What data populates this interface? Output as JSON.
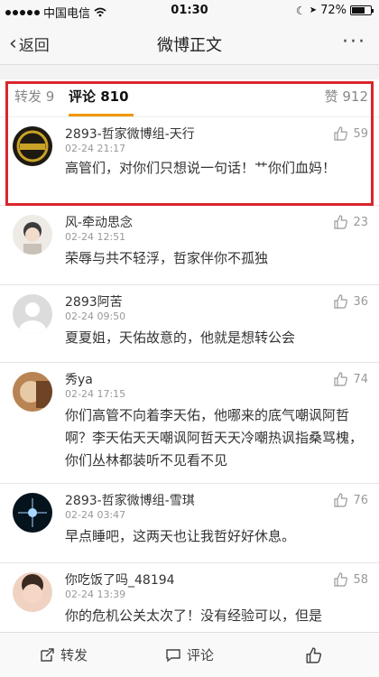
{
  "status": {
    "carrier": "中国电信",
    "time": "01:30",
    "battery": "72%",
    "battery_level": 0.72
  },
  "nav": {
    "back_label": "返回",
    "title": "微博正文",
    "more_label": "···"
  },
  "tabs": {
    "repost": "转发 9",
    "comment": "评论 810",
    "like": "赞 912"
  },
  "comments": [
    {
      "user": "2893-哲家微博组-天行",
      "time": "02-24 21:17",
      "likes": "59",
      "text": "高管们，对你们只想说一句话！艹你们血妈！",
      "avatar_color": "#3a2a12"
    },
    {
      "user": "风-牵动思念",
      "time": "02-24 12:51",
      "likes": "23",
      "text": "荣辱与共不轻浮，哲家伴你不孤独",
      "avatar_color": "#d8cfc8"
    },
    {
      "user": "2893阿苦",
      "time": "02-24 09:50",
      "likes": "36",
      "text": "夏夏姐，天佑故意的，他就是想转公会",
      "avatar_color": "#d9d9d9"
    },
    {
      "user": "秀ya",
      "time": "02-24 17:15",
      "likes": "74",
      "text": "你们高管不向着李天佑，他哪来的底气嘲讽阿哲啊？李天佑天天嘲讽阿哲天天冷嘲热讽指桑骂槐，你们丛林都装听不见看不见",
      "avatar_color": "#a8703e"
    },
    {
      "user": "2893-哲家微博组-雪琪",
      "time": "02-24 03:47",
      "likes": "76",
      "text": "早点睡吧，这两天也让我哲好好休息。",
      "avatar_color": "#0b1d2a"
    },
    {
      "user": "你吃饭了吗_48194",
      "time": "02-24 13:39",
      "likes": "58",
      "text": "你的危机公关太次了！没有经验可以，但是",
      "avatar_color": "#e7b7a3"
    }
  ],
  "toolbar": {
    "repost": "转发",
    "comment": "评论",
    "like": ""
  },
  "colors": {
    "accent": "#f39800",
    "highlight": "#d9262c"
  }
}
